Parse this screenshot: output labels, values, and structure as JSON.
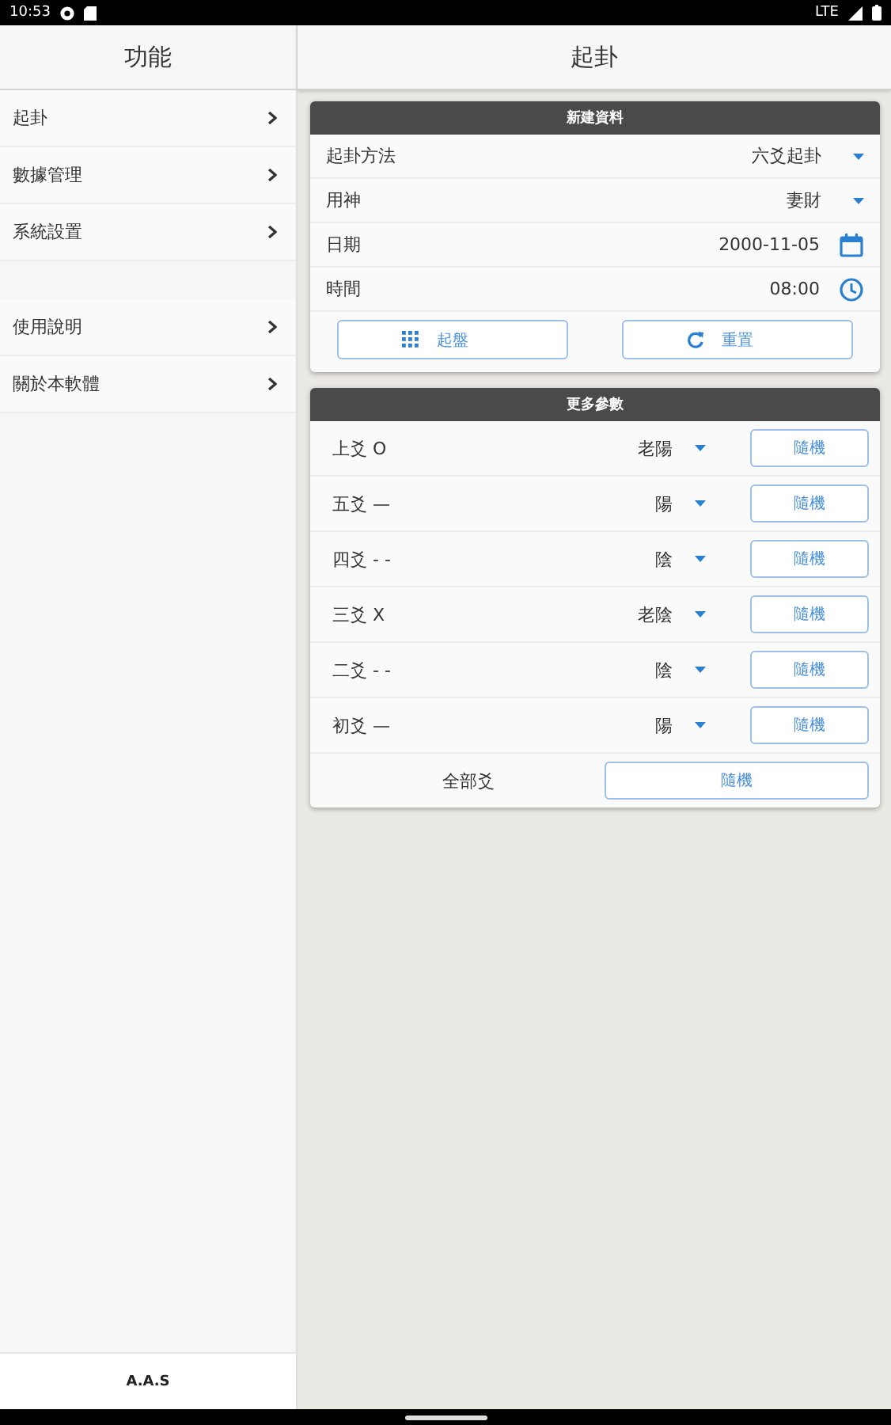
{
  "status_bar": {
    "time": "10:53",
    "network": "LTE"
  },
  "sidebar": {
    "title": "功能",
    "groups": [
      [
        {
          "label": "起卦"
        },
        {
          "label": "數據管理"
        },
        {
          "label": "系統設置"
        }
      ],
      [
        {
          "label": "使用說明"
        },
        {
          "label": "關於本軟體"
        }
      ]
    ],
    "footer": "A.A.S"
  },
  "header": {
    "title": "起卦"
  },
  "new_card": {
    "title": "新建資料",
    "rows": [
      {
        "kind": "select",
        "label": "起卦方法",
        "value": "六爻起卦"
      },
      {
        "kind": "select",
        "label": "用神",
        "value": "妻財"
      },
      {
        "kind": "date",
        "label": "日期",
        "value": "2000-11-05"
      },
      {
        "kind": "time",
        "label": "時間",
        "value": "08:00"
      }
    ],
    "buttons": [
      {
        "kind": "grid",
        "label": "起盤"
      },
      {
        "kind": "refresh",
        "label": "重置"
      }
    ]
  },
  "more_card": {
    "title": "更多參數",
    "rows": [
      {
        "label": "上爻 O",
        "value": "老陽",
        "button": "隨機"
      },
      {
        "label": "五爻 —",
        "value": "陽",
        "button": "隨機"
      },
      {
        "label": "四爻 - -",
        "value": "陰",
        "button": "隨機"
      },
      {
        "label": "三爻 X",
        "value": "老陰",
        "button": "隨機"
      },
      {
        "label": "二爻 - -",
        "value": "陰",
        "button": "隨機"
      },
      {
        "label": "初爻 —",
        "value": "陽",
        "button": "隨機"
      }
    ],
    "all": {
      "label": "全部爻",
      "button": "隨機"
    }
  }
}
